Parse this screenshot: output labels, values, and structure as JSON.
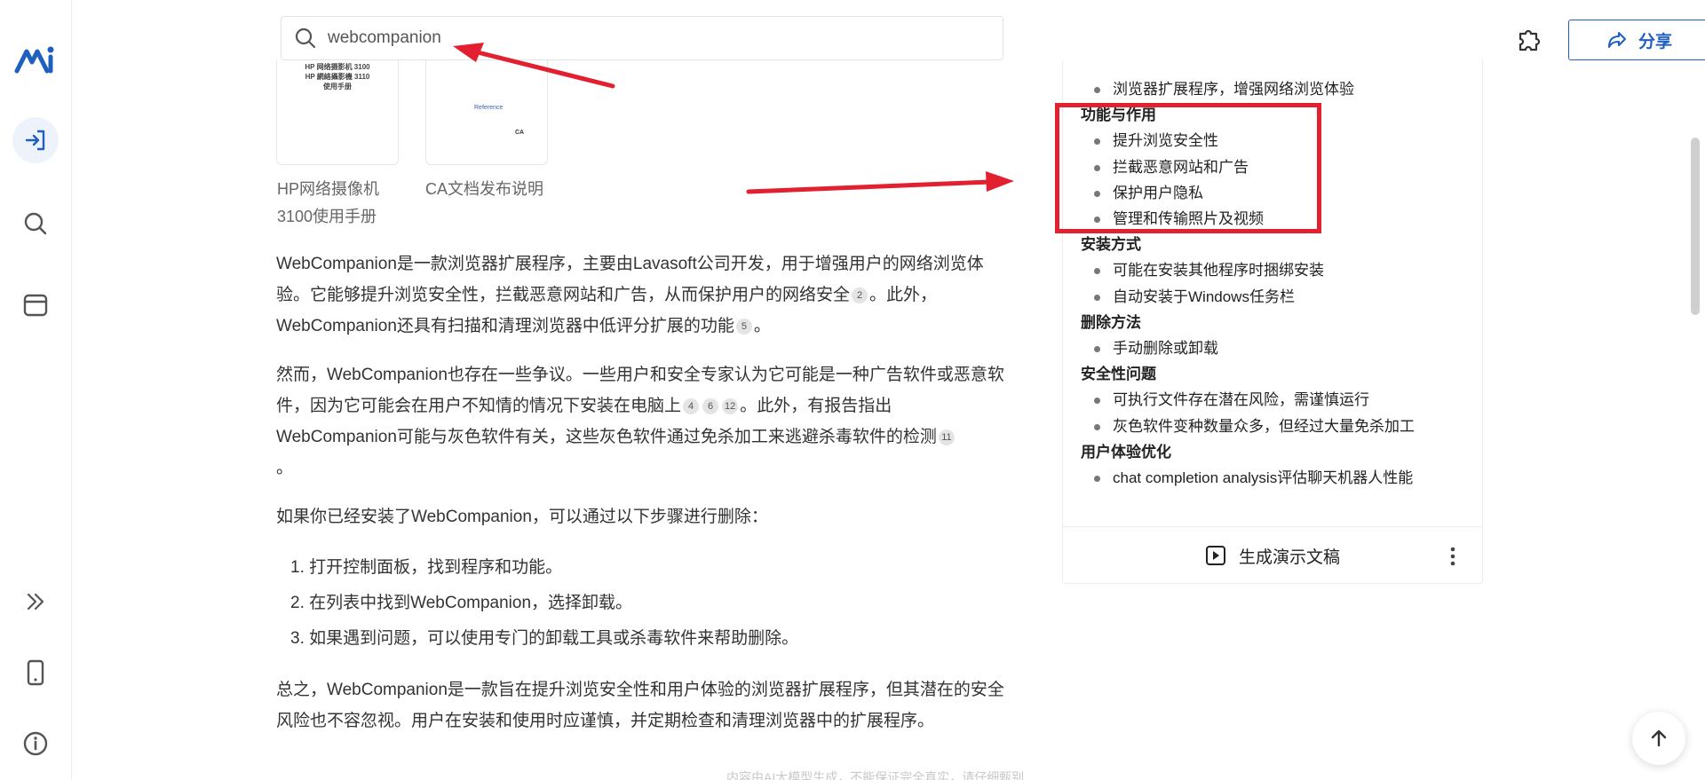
{
  "search": {
    "value": "webcompanion"
  },
  "header": {
    "share_label": "分享"
  },
  "thumbnails": [
    {
      "caption": "HP网络摄像机3100使用手册",
      "doc_lines": [
        "HP 网络摄影机 3100",
        "HP 網絡攝影機 3110",
        "使用手册"
      ]
    },
    {
      "caption": "CA文档发布说明",
      "doc_lines": [
        "Reference",
        "CA"
      ]
    }
  ],
  "article": {
    "p1": {
      "t1": "WebCompanion是一款浏览器扩展程序，主要由Lavasoft公司开发，用于增强用户的网络浏览体验。它能够提升浏览安全性，拦截恶意网站和广告，从而保护用户的网络安全",
      "c1": "2",
      "t2": "。此外，WebCompanion还具有扫描和清理浏览器中低评分扩展的功能",
      "c2": "5",
      "t3": "。"
    },
    "p2": {
      "t1": "然而，WebCompanion也存在一些争议。一些用户和安全专家认为它可能是一种广告软件或恶意软件，因为它可能会在用户不知情的情况下安装在电脑上",
      "c1": "4",
      "c2": "6",
      "c3": "12",
      "t2": "。此外，有报告指出WebCompanion可能与灰色软件有关，这些灰色软件通过免杀加工来逃避杀毒软件的检测",
      "c4": "11",
      "t3": "。"
    },
    "p3": "如果你已经安装了WebCompanion，可以通过以下步骤进行删除：",
    "steps": [
      "1. 打开控制面板，找到程序和功能。",
      "2. 在列表中找到WebCompanion，选择卸载。",
      "3. 如果遇到问题，可以使用专门的卸载工具或杀毒软件来帮助删除。"
    ],
    "p4": "总之，WebCompanion是一款旨在提升浏览安全性和用户体验的浏览器扩展程序，但其潜在的安全风险也不容忽视。用户在安装和使用时应谨慎，并定期检查和清理浏览器中的扩展程序。"
  },
  "footnote": "内容由AI大模型生成，不能保证完全真实，请仔细甄别",
  "panel": {
    "top_item": "浏览器扩展程序，增强网络浏览体验",
    "sections": [
      {
        "heading": "功能与作用",
        "items": [
          "提升浏览安全性",
          "拦截恶意网站和广告",
          "保护用户隐私",
          "管理和传输照片及视频"
        ]
      },
      {
        "heading": "安装方式",
        "items": [
          "可能在安装其他程序时捆绑安装",
          "自动安装于Windows任务栏"
        ]
      },
      {
        "heading": "删除方法",
        "items": [
          "手动删除或卸载"
        ]
      },
      {
        "heading": "安全性问题",
        "items": [
          "可执行文件存在潜在风险，需谨慎运行",
          "灰色软件变种数量众多，但经过大量免杀加工"
        ]
      },
      {
        "heading": "用户体验优化",
        "items": [
          "chat completion analysis评估聊天机器人性能"
        ]
      }
    ],
    "generate_label": "生成演示文稿"
  },
  "colors": {
    "accent": "#1f5fbf",
    "annotation": "#e3202f"
  }
}
